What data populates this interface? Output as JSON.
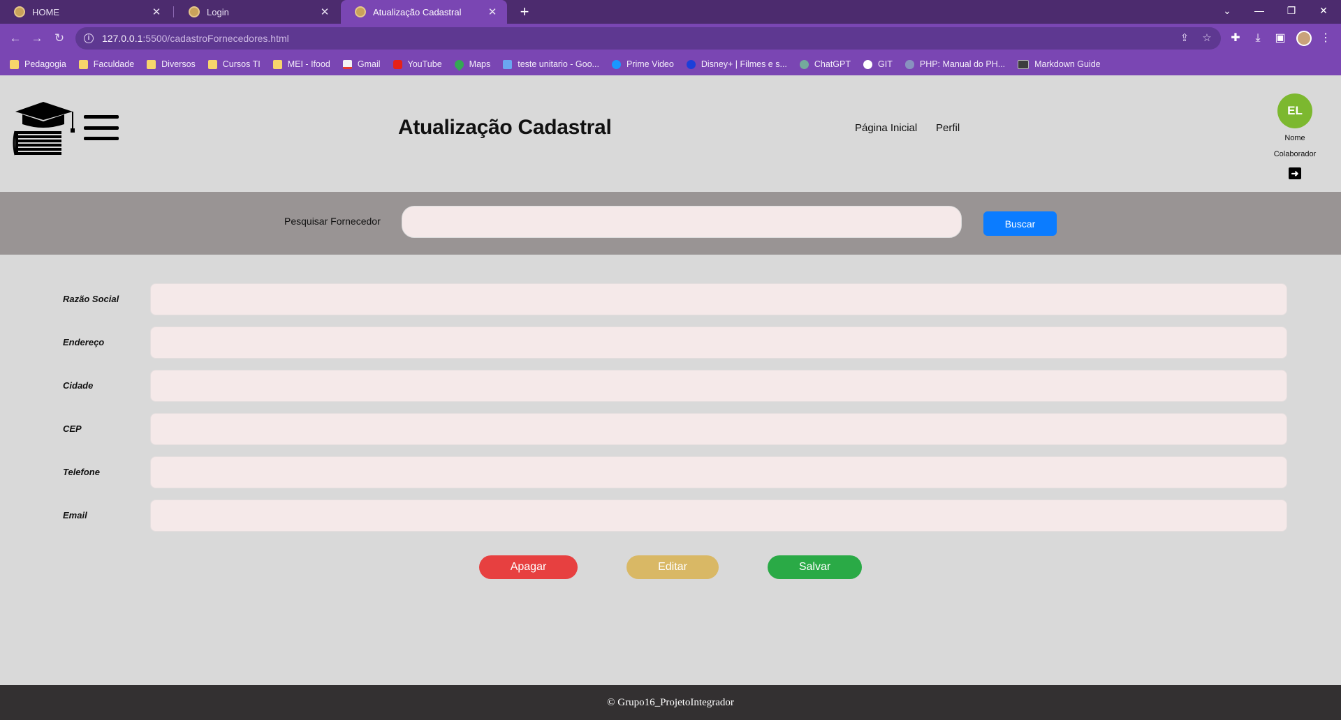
{
  "browser": {
    "tabs": [
      {
        "label": "HOME"
      },
      {
        "label": "Login"
      },
      {
        "label": "Atualização Cadastral"
      }
    ],
    "url_host": "127.0.0.1",
    "url_rest": ":5500/cadastroFornecedores.html",
    "bookmarks": [
      {
        "label": "Pedagogia",
        "icon": "folder-icon"
      },
      {
        "label": "Faculdade",
        "icon": "folder-icon"
      },
      {
        "label": "Diversos",
        "icon": "folder-icon"
      },
      {
        "label": "Cursos TI",
        "icon": "folder-icon"
      },
      {
        "label": "MEI - Ifood",
        "icon": "folder-icon"
      },
      {
        "label": "Gmail",
        "icon": "gmail-icon"
      },
      {
        "label": "YouTube",
        "icon": "youtube-icon"
      },
      {
        "label": "Maps",
        "icon": "maps-icon"
      },
      {
        "label": "teste unitario - Goo...",
        "icon": "graduation-cap-icon"
      },
      {
        "label": "Prime Video",
        "icon": "prime-video-icon"
      },
      {
        "label": "Disney+ | Filmes e s...",
        "icon": "disney-icon"
      },
      {
        "label": "ChatGPT",
        "icon": "chatgpt-icon"
      },
      {
        "label": "GIT",
        "icon": "github-icon"
      },
      {
        "label": "PHP: Manual do PH...",
        "icon": "php-icon"
      },
      {
        "label": "Markdown Guide",
        "icon": "markdown-icon"
      }
    ]
  },
  "header": {
    "title": "Atualização Cadastral",
    "nav": [
      {
        "label": "Página Inicial"
      },
      {
        "label": "Perfil"
      }
    ],
    "user": {
      "initials": "EL",
      "name": "Nome",
      "role": "Colaborador"
    }
  },
  "search": {
    "label": "Pesquisar Fornecedor",
    "value": "",
    "button": "Buscar"
  },
  "form": {
    "fields": [
      {
        "label": "Razão Social",
        "value": ""
      },
      {
        "label": "Endereço",
        "value": ""
      },
      {
        "label": "Cidade",
        "value": ""
      },
      {
        "label": "CEP",
        "value": ""
      },
      {
        "label": "Telefone",
        "value": ""
      },
      {
        "label": "Email",
        "value": ""
      }
    ]
  },
  "actions": {
    "delete": "Apagar",
    "edit": "Editar",
    "save": "Salvar"
  },
  "footer": {
    "text": "© Grupo16_ProjetoIntegrador"
  },
  "colors": {
    "browser_accent": "#7a46b3",
    "avatar": "#7cb82f",
    "buscar": "#0b7cff",
    "apagar": "#e74040",
    "editar": "#d9b865",
    "salvar": "#2aaa46"
  }
}
